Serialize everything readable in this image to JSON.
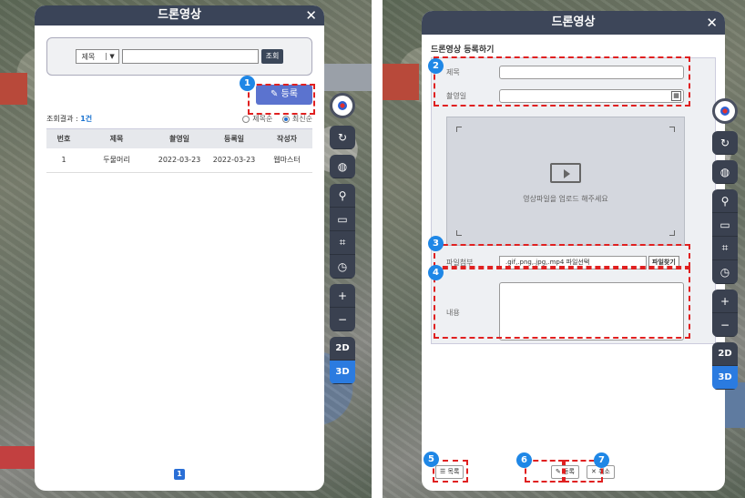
{
  "left_panel": {
    "title": "드론영상",
    "close_icon": "close-icon",
    "search": {
      "select_value": "제목",
      "input_value": "",
      "button_label": "조회"
    },
    "register_button_label": "등록",
    "result_label": "조회결과 : ",
    "result_count": "1건",
    "sort_options": [
      "제목순",
      "최신순"
    ],
    "sort_selected": "최신순",
    "table": {
      "headers": [
        "번호",
        "제목",
        "촬영일",
        "등록일",
        "작성자"
      ],
      "rows": [
        [
          "1",
          "두물머리",
          "2022-03-23",
          "2022-03-23",
          "웹마스터"
        ]
      ]
    },
    "page": "1"
  },
  "right_panel": {
    "title": "드론영상",
    "form_title": "드론영상 등록하기",
    "labels": {
      "title": "제목",
      "date": "촬영일",
      "file": "파일첨부",
      "content": "내용"
    },
    "drop_text": "영상파일을 업로드 해주세요",
    "file_placeholder": ".gif,.png,.jpg,.mp4 파일선택",
    "file_button": "파일찾기",
    "list_button": "목록",
    "register_button": "등록",
    "cancel_button": "취소"
  },
  "side_toolbar": {
    "buttons": [
      "compass-icon",
      "refresh-icon",
      "globe-icon",
      "location-icon",
      "ruler-icon",
      "area-icon",
      "clock-icon",
      "zoom-in-icon",
      "zoom-out-icon"
    ],
    "mode_2d": "2D",
    "mode_3d": "3D"
  },
  "badges": [
    "1",
    "2",
    "3",
    "4",
    "5",
    "6",
    "7"
  ],
  "colors": {
    "header": "#3a4458",
    "accent": "#2b7be0",
    "highlight": "#e02020",
    "register_button": "#5b73cf"
  }
}
